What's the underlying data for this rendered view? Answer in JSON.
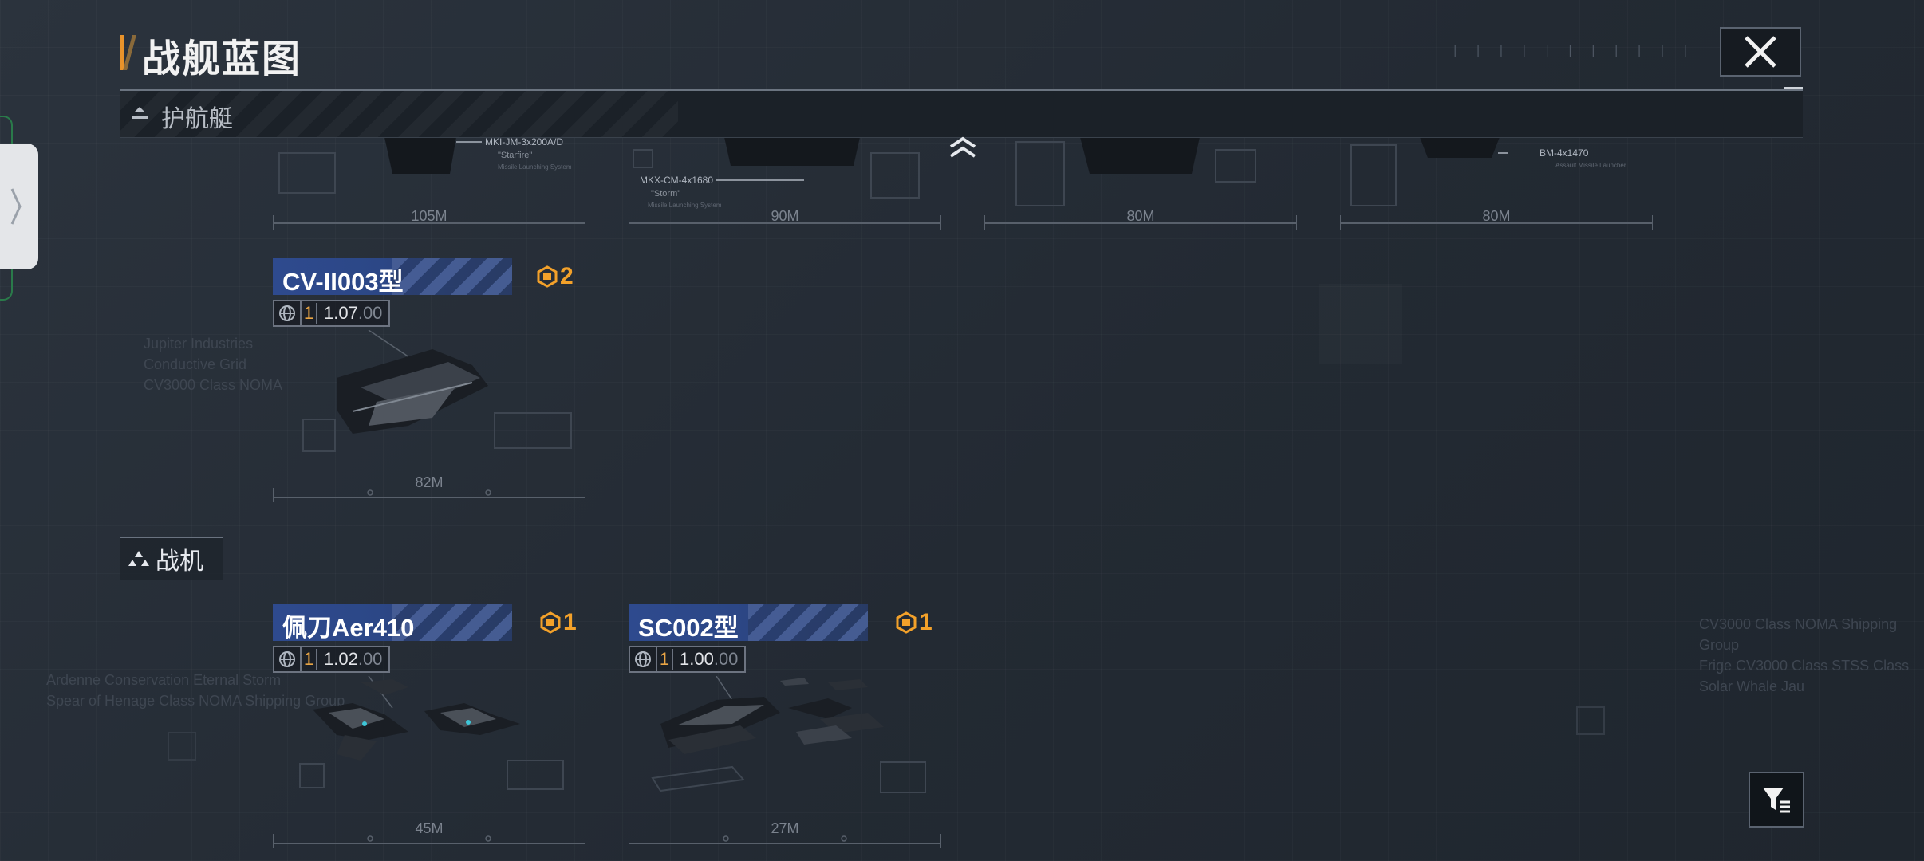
{
  "header": {
    "title": "战舰蓝图",
    "close_icon": "close-icon"
  },
  "section": {
    "label": "护航艇",
    "icon": "escort-boat-icon"
  },
  "top_row": [
    {
      "length": "105M",
      "callout": "ⓃMKI-JM-3x200A/D",
      "callout_sub": "\"Starfire\""
    },
    {
      "length": "90M",
      "callout": "ⓃMKX-CM-4x1680",
      "callout_sub": "\"Storm\""
    },
    {
      "length": "80M",
      "callout": "",
      "callout_sub": ""
    },
    {
      "length": "80M",
      "callout": "ⓃBM-4x1470",
      "callout_sub": "Assault Missile Launcher"
    }
  ],
  "escort_cards": [
    {
      "name": "CV-II003型",
      "count": "2",
      "rank_level": "1",
      "rank_value_main": "1.07",
      "rank_value_dim": ".00",
      "length": "82M"
    }
  ],
  "fighter_category": {
    "label": "战机",
    "icon": "fighter-icon"
  },
  "fighter_cards": [
    {
      "name": "佩刀Aer410",
      "count": "1",
      "rank_level": "1",
      "rank_value_main": "1.02",
      "rank_value_dim": ".00",
      "length": "45M"
    },
    {
      "name": "SC002型",
      "count": "1",
      "rank_level": "1",
      "rank_value_main": "1.00",
      "rank_value_dim": ".00",
      "length": "27M"
    }
  ],
  "colors": {
    "accent": "#e8932b",
    "card_title": "#2c4786",
    "count": "#f3a12a",
    "background": "#222a33"
  }
}
